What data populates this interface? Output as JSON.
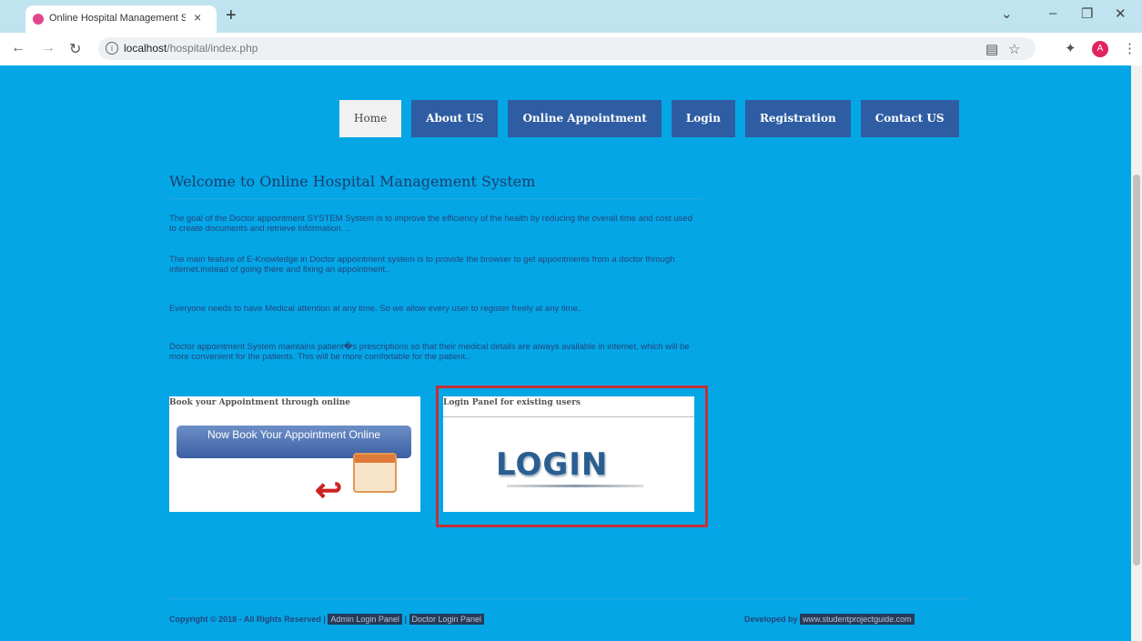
{
  "browser": {
    "tab_title": "Online Hospital Management S",
    "tab_close": "×",
    "new_tab": "+",
    "window_controls": [
      "⌄",
      "–",
      "❐",
      "✕"
    ],
    "url_host": "localhost",
    "url_path": "/hospital/index.php",
    "avatar_letter": "A"
  },
  "nav": {
    "items": [
      "Home",
      "About US",
      "Online Appointment",
      "Login",
      "Registration",
      "Contact US"
    ],
    "active": "Home"
  },
  "content": {
    "heading": "Welcome to Online Hospital Management System",
    "paragraphs": [
      "The goal of the Doctor appointment SYSTEM System is to improve the efficiency of the health by reducing the overall time and cost used to create documents and retrieve information. ..",
      "The main feature of E-Knowledge in Doctor appointment system is to provide the browser to get appointments from a doctor through internet.instead of going there and fixing an appointment..",
      "Everyone needs to have Medical attention at any time. So we allow every user to register freely at any time..",
      "Doctor appointment System maintains patient�s prescriptions so that their medical details are always available in internet, which will be more convenient for the patients. This will be more comfortable for the patient.."
    ],
    "book_title": "Book your Appointment through online",
    "book_banner": "Now Book Your Appointment Online",
    "login_title": "Login Panel for existing users",
    "login_logo": "LOGIN"
  },
  "footer": {
    "copyright": "Copyright © 2018 - All Rights Reserved |",
    "admin_link": "Admin Login Panel",
    "separator": "|",
    "doctor_link": "Doctor Login Panel",
    "developed_by": "Developed by",
    "dev_link": "www.studentprojectguide.com"
  }
}
